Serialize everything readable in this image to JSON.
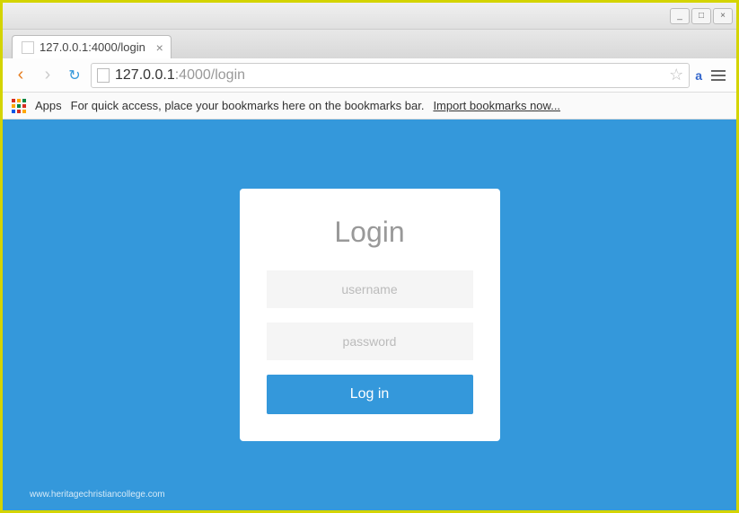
{
  "window": {
    "minimize": "_",
    "maximize": "□",
    "close": "×"
  },
  "tab": {
    "title": "127.0.0.1:4000/login",
    "close": "×"
  },
  "urlbar": {
    "host": "127.0.0.1",
    "path": ":4000/login"
  },
  "textcontrol": "a",
  "bookmarks": {
    "apps_label": "Apps",
    "hint": "For quick access, place your bookmarks here on the bookmarks bar.",
    "import_link": "Import bookmarks now..."
  },
  "login": {
    "title": "Login",
    "username_placeholder": "username",
    "password_placeholder": "password",
    "button": "Log in"
  },
  "watermark": "www.heritagechristiancollege.com"
}
